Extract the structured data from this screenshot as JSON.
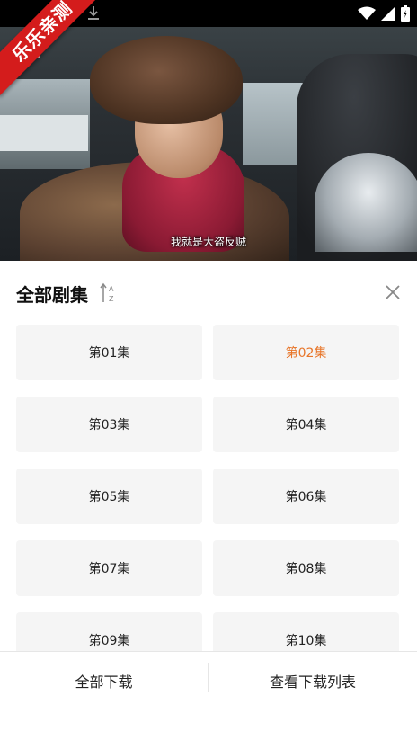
{
  "watermark": "乐乐亲测",
  "video": {
    "subtitle": "我就是大盗反贼"
  },
  "sheet": {
    "title": "全部剧集",
    "episodes": [
      {
        "label": "第01集"
      },
      {
        "label": "第02集"
      },
      {
        "label": "第03集"
      },
      {
        "label": "第04集"
      },
      {
        "label": "第05集"
      },
      {
        "label": "第06集"
      },
      {
        "label": "第07集"
      },
      {
        "label": "第08集"
      },
      {
        "label": "第09集"
      },
      {
        "label": "第10集"
      }
    ],
    "active_episode": "第02集",
    "download_all": "全部下载",
    "view_download_list": "查看下载列表"
  },
  "colors": {
    "accent": "#e8762a",
    "ribbon": "#d41c1c",
    "tile": "#f5f5f5"
  }
}
